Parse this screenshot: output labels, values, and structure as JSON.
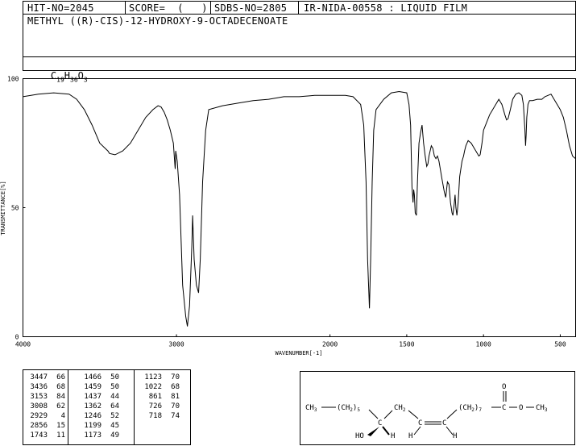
{
  "header": {
    "hit_no": "HIT-NO=2045",
    "score": "SCORE=  (   )",
    "sdbs_no": "SDBS-NO=2805",
    "ir_id": "IR-NIDA-00558 : LIQUID FILM",
    "compound_name": "METHYL ((R)-CIS)-12-HYDROXY-9-OCTADECENOATE",
    "formula_parts": [
      "C",
      "19",
      "H",
      "36",
      "O",
      "3"
    ]
  },
  "chart_data": {
    "type": "line",
    "xlabel": "WAVENUMBER[-1]",
    "ylabel": "TRANSMITTANCE[%]",
    "xlim": [
      4000,
      400
    ],
    "ylim": [
      0,
      100
    ],
    "x_ticks": [
      4000,
      3000,
      2000,
      1500,
      1000,
      500
    ],
    "y_ticks": [
      0,
      50,
      100
    ],
    "grid": false,
    "series": [
      {
        "points": [
          [
            4000,
            93
          ],
          [
            3900,
            94
          ],
          [
            3800,
            94.5
          ],
          [
            3700,
            94
          ],
          [
            3650,
            92
          ],
          [
            3600,
            88
          ],
          [
            3550,
            82
          ],
          [
            3500,
            75
          ],
          [
            3447,
            72
          ],
          [
            3436,
            71
          ],
          [
            3400,
            70.5
          ],
          [
            3350,
            72
          ],
          [
            3300,
            75
          ],
          [
            3250,
            80
          ],
          [
            3200,
            85
          ],
          [
            3153,
            88
          ],
          [
            3120,
            89.5
          ],
          [
            3100,
            89
          ],
          [
            3080,
            87
          ],
          [
            3060,
            84
          ],
          [
            3040,
            80
          ],
          [
            3020,
            75
          ],
          [
            3010,
            66
          ],
          [
            3008,
            65
          ],
          [
            3005,
            72
          ],
          [
            2995,
            68
          ],
          [
            2980,
            55
          ],
          [
            2960,
            20
          ],
          [
            2940,
            8
          ],
          [
            2929,
            4
          ],
          [
            2915,
            12
          ],
          [
            2900,
            35
          ],
          [
            2895,
            47
          ],
          [
            2885,
            30
          ],
          [
            2870,
            20
          ],
          [
            2856,
            17
          ],
          [
            2845,
            30
          ],
          [
            2830,
            60
          ],
          [
            2810,
            80
          ],
          [
            2790,
            88
          ],
          [
            2700,
            89.5
          ],
          [
            2600,
            90.5
          ],
          [
            2500,
            91.5
          ],
          [
            2400,
            92
          ],
          [
            2300,
            93
          ],
          [
            2200,
            93
          ],
          [
            2100,
            93.5
          ],
          [
            2000,
            93.5
          ],
          [
            1900,
            93.5
          ],
          [
            1850,
            93
          ],
          [
            1800,
            90
          ],
          [
            1780,
            82
          ],
          [
            1765,
            60
          ],
          [
            1755,
            30
          ],
          [
            1743,
            11
          ],
          [
            1735,
            30
          ],
          [
            1725,
            60
          ],
          [
            1715,
            80
          ],
          [
            1700,
            88
          ],
          [
            1650,
            92
          ],
          [
            1600,
            94.5
          ],
          [
            1550,
            95
          ],
          [
            1500,
            94.5
          ],
          [
            1485,
            90
          ],
          [
            1475,
            82
          ],
          [
            1466,
            58
          ],
          [
            1462,
            55
          ],
          [
            1459,
            52
          ],
          [
            1455,
            57
          ],
          [
            1450,
            55
          ],
          [
            1445,
            48
          ],
          [
            1437,
            47
          ],
          [
            1430,
            60
          ],
          [
            1420,
            75
          ],
          [
            1410,
            79
          ],
          [
            1400,
            82
          ],
          [
            1390,
            75
          ],
          [
            1380,
            70
          ],
          [
            1370,
            66
          ],
          [
            1362,
            67
          ],
          [
            1355,
            70
          ],
          [
            1340,
            74
          ],
          [
            1330,
            73
          ],
          [
            1320,
            70
          ],
          [
            1310,
            69
          ],
          [
            1300,
            70
          ],
          [
            1290,
            68
          ],
          [
            1270,
            61
          ],
          [
            1255,
            56
          ],
          [
            1246,
            54
          ],
          [
            1235,
            60
          ],
          [
            1225,
            59
          ],
          [
            1215,
            52
          ],
          [
            1205,
            48
          ],
          [
            1199,
            47
          ],
          [
            1190,
            52
          ],
          [
            1185,
            55
          ],
          [
            1180,
            50
          ],
          [
            1173,
            47
          ],
          [
            1165,
            52
          ],
          [
            1155,
            62
          ],
          [
            1140,
            68
          ],
          [
            1130,
            70
          ],
          [
            1123,
            72
          ],
          [
            1115,
            74
          ],
          [
            1100,
            76
          ],
          [
            1080,
            75
          ],
          [
            1060,
            73
          ],
          [
            1040,
            71
          ],
          [
            1030,
            70
          ],
          [
            1022,
            70.5
          ],
          [
            1010,
            75
          ],
          [
            1000,
            80
          ],
          [
            980,
            83
          ],
          [
            960,
            86
          ],
          [
            940,
            88
          ],
          [
            920,
            90
          ],
          [
            900,
            92
          ],
          [
            880,
            90
          ],
          [
            861,
            86
          ],
          [
            850,
            84
          ],
          [
            840,
            84.5
          ],
          [
            825,
            88
          ],
          [
            810,
            92
          ],
          [
            790,
            94
          ],
          [
            770,
            94.5
          ],
          [
            750,
            93.5
          ],
          [
            740,
            90
          ],
          [
            730,
            80
          ],
          [
            726,
            74
          ],
          [
            722,
            78
          ],
          [
            718,
            85
          ],
          [
            710,
            90
          ],
          [
            700,
            91.5
          ],
          [
            680,
            91.5
          ],
          [
            650,
            92
          ],
          [
            620,
            92
          ],
          [
            600,
            93
          ],
          [
            580,
            93.5
          ],
          [
            560,
            94
          ],
          [
            540,
            92
          ],
          [
            520,
            90
          ],
          [
            500,
            88
          ],
          [
            480,
            85
          ],
          [
            460,
            80
          ],
          [
            440,
            74
          ],
          [
            420,
            70
          ],
          [
            400,
            69
          ]
        ]
      }
    ]
  },
  "peak_table": {
    "columns": [
      [
        [
          "3447",
          "66"
        ],
        [
          "3436",
          "68"
        ],
        [
          "3153",
          "84"
        ],
        [
          "3008",
          "62"
        ],
        [
          "2929",
          "4"
        ],
        [
          "2856",
          "15"
        ],
        [
          "1743",
          "11"
        ]
      ],
      [
        [
          "1466",
          "50"
        ],
        [
          "1459",
          "50"
        ],
        [
          "1437",
          "44"
        ],
        [
          "1362",
          "64"
        ],
        [
          "1246",
          "52"
        ],
        [
          "1199",
          "45"
        ],
        [
          "1173",
          "49"
        ]
      ],
      [
        [
          "1123",
          "70"
        ],
        [
          "1022",
          "68"
        ],
        [
          "861",
          "81"
        ],
        [
          "726",
          "70"
        ],
        [
          "718",
          "74"
        ]
      ]
    ]
  },
  "structure": {
    "atoms": [
      "O",
      "CH3",
      "(CH2)5",
      "CH2",
      "(CH2)7",
      "C",
      "O",
      "CH3",
      "C",
      "C",
      "C",
      "HO",
      "H",
      "H",
      "H"
    ],
    "methyl_left": [
      "CH",
      "3"
    ],
    "ch2_5": [
      "(CH",
      "2",
      ")",
      "5"
    ],
    "ch2_mid": [
      "CH",
      "2"
    ],
    "ch2_7": [
      "(CH",
      "2",
      ")",
      "7"
    ],
    "methyl_right": [
      "CH",
      "3"
    ]
  }
}
